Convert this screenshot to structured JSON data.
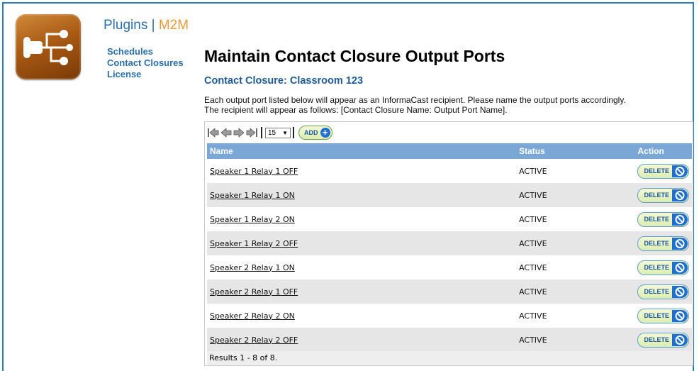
{
  "header": {
    "plugins_label": "Plugins",
    "separator": "|",
    "m2m_label": "M2M"
  },
  "sidenav": {
    "items": [
      {
        "label": "Schedules"
      },
      {
        "label": "Contact Closures"
      },
      {
        "label": "License"
      }
    ]
  },
  "main": {
    "title": "Maintain Contact Closure Output Ports",
    "subtitle": "Contact Closure: Classroom 123",
    "description_line1": "Each output port listed below will appear as an InformaCast recipient. Please name the output ports accordingly.",
    "description_line2": "The recipient will appear as follows: [Contact Closure Name: Output Port Name]."
  },
  "pager": {
    "page_size": "15",
    "add_label": "ADD"
  },
  "table": {
    "columns": [
      "Name",
      "Status",
      "Action"
    ],
    "rows": [
      {
        "name": "Speaker 1 Relay 1 OFF",
        "status": "ACTIVE",
        "action": "DELETE"
      },
      {
        "name": "Speaker 1 Relay 1 ON",
        "status": "ACTIVE",
        "action": "DELETE"
      },
      {
        "name": "Speaker 1 Relay 2 ON",
        "status": "ACTIVE",
        "action": "DELETE"
      },
      {
        "name": "Speaker 1 Relay 2 OFF",
        "status": "ACTIVE",
        "action": "DELETE"
      },
      {
        "name": "Speaker 2 Relay 1 ON",
        "status": "ACTIVE",
        "action": "DELETE"
      },
      {
        "name": "Speaker 2 Relay 1 OFF",
        "status": "ACTIVE",
        "action": "DELETE"
      },
      {
        "name": "Speaker 2 Relay 2 ON",
        "status": "ACTIVE",
        "action": "DELETE"
      },
      {
        "name": "Speaker 2 Relay 2 OFF",
        "status": "ACTIVE",
        "action": "DELETE"
      }
    ],
    "results": "Results 1 - 8 of 8."
  },
  "colors": {
    "accent_blue": "#2b6fad",
    "m2m_orange": "#e89a3c",
    "header_row": "#7aa7d6",
    "frame_border": "#2a7fc1"
  },
  "icons": [
    "plugin-logo-icon",
    "first-page-icon",
    "prev-page-icon",
    "next-page-icon",
    "last-page-icon",
    "add-plus-icon",
    "delete-cancel-icon"
  ]
}
